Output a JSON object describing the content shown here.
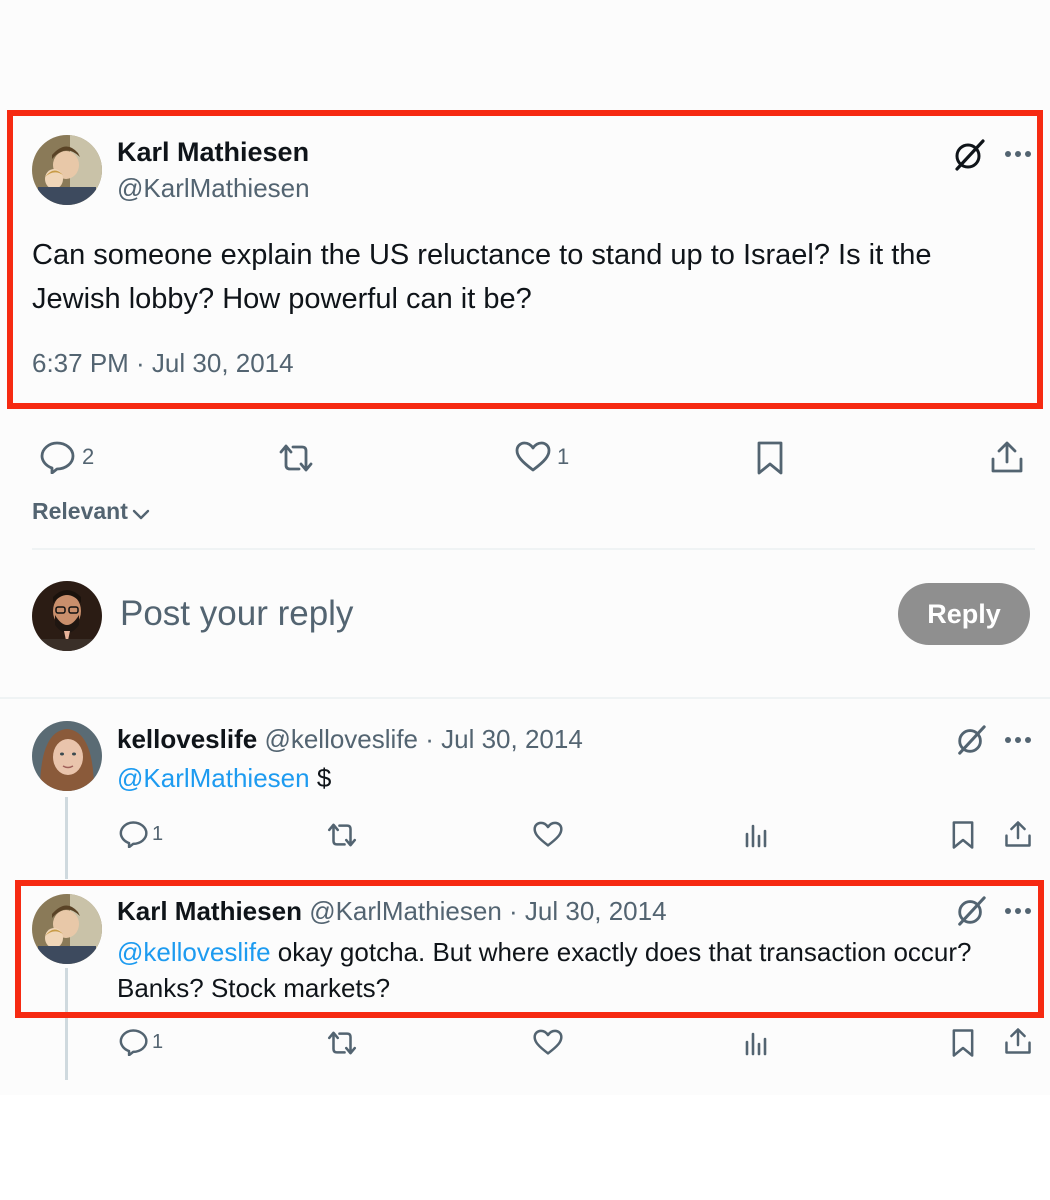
{
  "main_tweet": {
    "author_name": "Karl Mathiesen",
    "author_handle": "@KarlMathiesen",
    "text": "Can someone explain the US reluctance to stand up to Israel? Is it the Jewish lobby? How powerful can it be?",
    "timestamp": "6:37 PM · Jul 30, 2014",
    "stats": {
      "replies": "2",
      "likes": "1"
    }
  },
  "sort": {
    "label": "Relevant"
  },
  "compose": {
    "placeholder": "Post your reply",
    "button_label": "Reply"
  },
  "replies": [
    {
      "author_name": "kelloveslife",
      "author_handle": "@kelloveslife",
      "date": "· Jul 30, 2014",
      "mention": "@KarlMathiesen",
      "text": " $",
      "replies_count": "1"
    },
    {
      "author_name": "Karl Mathiesen",
      "author_handle": "@KarlMathiesen",
      "date": "· Jul 30, 2014",
      "mention": "@kelloveslife",
      "text": " okay gotcha. But where exactly does that transaction occur? Banks? Stock markets?",
      "replies_count": "1"
    }
  ],
  "colors": {
    "highlight": "#f62a12",
    "mention": "#1d9bf0",
    "muted": "#536471",
    "reply_button": "#8f8f8f"
  },
  "icons": [
    "grok-icon",
    "more-icon",
    "reply-icon",
    "retweet-icon",
    "like-icon",
    "bookmark-icon",
    "share-icon",
    "views-icon",
    "chevron-down-icon"
  ]
}
